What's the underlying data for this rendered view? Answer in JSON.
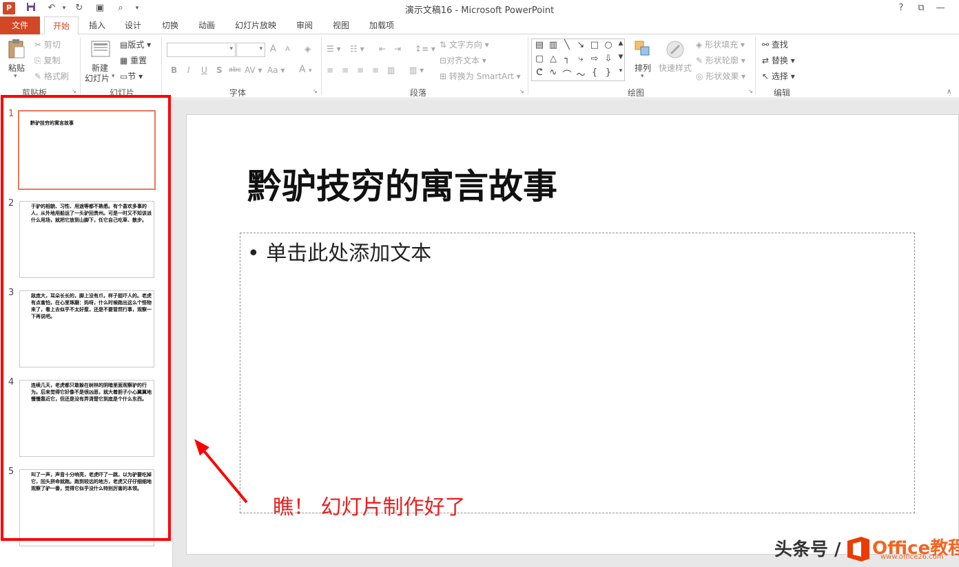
{
  "window": {
    "title": "演示文稿16 - Microsoft PowerPoint",
    "help": "?",
    "minimize": "—"
  },
  "qat": {
    "logo": "P"
  },
  "tabs": [
    "文件",
    "开始",
    "插入",
    "设计",
    "切换",
    "动画",
    "幻灯片放映",
    "审阅",
    "视图",
    "加载项"
  ],
  "ribbon": {
    "clipboard": {
      "paste": "粘贴",
      "cut": "剪切",
      "copy": "复制",
      "format_painter": "格式刷",
      "label": "剪贴板"
    },
    "slides": {
      "new_slide": "新建",
      "new_slide_2": "幻灯片",
      "layout": "版式",
      "reset": "重置",
      "section": "节",
      "label": "幻灯片"
    },
    "font": {
      "label": "字体",
      "bold": "B",
      "italic": "I",
      "underline": "U",
      "shadow": "S",
      "strike": "abc",
      "spacing": "AV",
      "case": "Aa",
      "color": "A",
      "grow": "A",
      "shrink": "A"
    },
    "paragraph": {
      "label": "段落",
      "text_direction": "文字方向",
      "align_text": "对齐文本",
      "smartart": "转换为 SmartArt"
    },
    "drawing": {
      "label": "绘图",
      "arrange": "排列",
      "quick_styles": "快速样式",
      "shape_fill": "形状填充",
      "shape_outline": "形状轮廓",
      "shape_effects": "形状效果"
    },
    "editing": {
      "label": "编辑",
      "find": "查找",
      "replace": "替换",
      "select": "选择"
    }
  },
  "thumbnails": [
    {
      "num": "1",
      "text": "黔驴技穷的寓言故事"
    },
    {
      "num": "2",
      "text": "于驴的相貌、习性、用途等都不熟悉。有个喜欢多事的人，从外地用船运了一头驴回贵州。可是一时又不知该派什么用场，就把它放到山脚下，任它自己吃草、散步。"
    },
    {
      "num": "3",
      "text": "敌庞大，耳朵长长的，脚上没有爪，样子挺吓人的。老虎有点害怕，在心里琢磨：妈呀，什么时候跑出这么个怪物来了，看上去似乎不太好惹，还是不要冒然行事，观察一下再说吧。"
    },
    {
      "num": "4",
      "text": "连续几天，老虎都只敢躲在树林的阴暗里面观察驴的行为。后来觉得它好像不是很凶恶，就大着胆子小心翼翼地慢慢靠近它，但还是没有弄清楚它到底是个什么东西。"
    },
    {
      "num": "5",
      "text": "叫了一声，声音十分响亮，老虎吓了一跳，以为驴要吃掉它，回头拼命就跑。跑到较远的地方，老虎又仔仔细细地观察了驴一番，觉得它似乎没什么特别厉害的本领。"
    }
  ],
  "slide": {
    "title": "黔驴技穷的寓言故事",
    "content_placeholder": "• 单击此处添加文本"
  },
  "annotation": "瞧！ 幻灯片制作好了",
  "watermark": {
    "prefix": "头条号 /",
    "brand": "Office教程网",
    "url": "www.office26.com"
  },
  "colors": {
    "accent": "#d24726",
    "annotation": "#ff0000"
  }
}
